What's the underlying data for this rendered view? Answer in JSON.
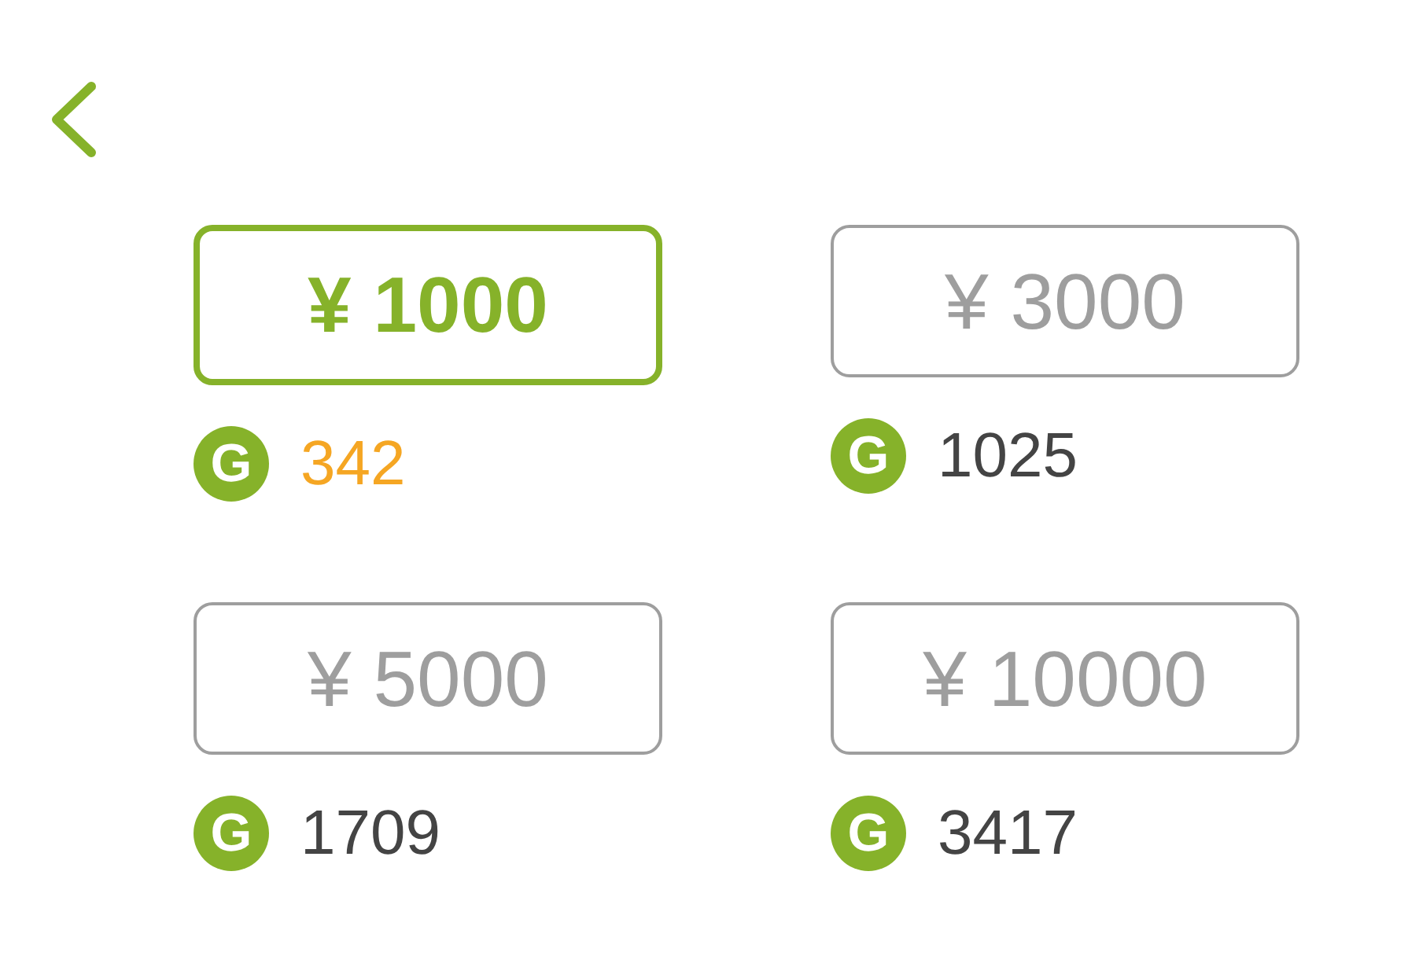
{
  "options": [
    {
      "price": "¥ 1000",
      "symbol": "G",
      "coins": "342",
      "selected": true
    },
    {
      "price": "¥ 3000",
      "symbol": "G",
      "coins": "1025",
      "selected": false
    },
    {
      "price": "¥ 5000",
      "symbol": "G",
      "coins": "1709",
      "selected": false
    },
    {
      "price": "¥ 10000",
      "symbol": "G",
      "coins": "3417",
      "selected": false
    }
  ]
}
